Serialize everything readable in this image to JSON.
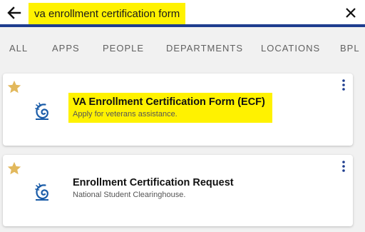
{
  "search": {
    "query": "va enrollment certification form"
  },
  "tabs": [
    "ALL",
    "APPS",
    "PEOPLE",
    "DEPARTMENTS",
    "LOCATIONS",
    "BPL"
  ],
  "results": [
    {
      "title": "VA Enrollment Certification Form (ECF)",
      "subtitle": "Apply for veterans assistance."
    },
    {
      "title": "Enrollment Certification Request",
      "subtitle": "National Student Clearinghouse."
    }
  ],
  "colors": {
    "accent_bar": "#1e3d8f",
    "highlight": "#fff200",
    "star": "#e2b85c",
    "kebab": "#1e3d8f",
    "logo": "#1a5ca8"
  },
  "icons": {
    "back": "arrow-left-icon",
    "close": "close-icon",
    "favorite": "star-icon",
    "menu": "kebab-menu-icon",
    "app_logo": "nautilus-logo-icon"
  }
}
